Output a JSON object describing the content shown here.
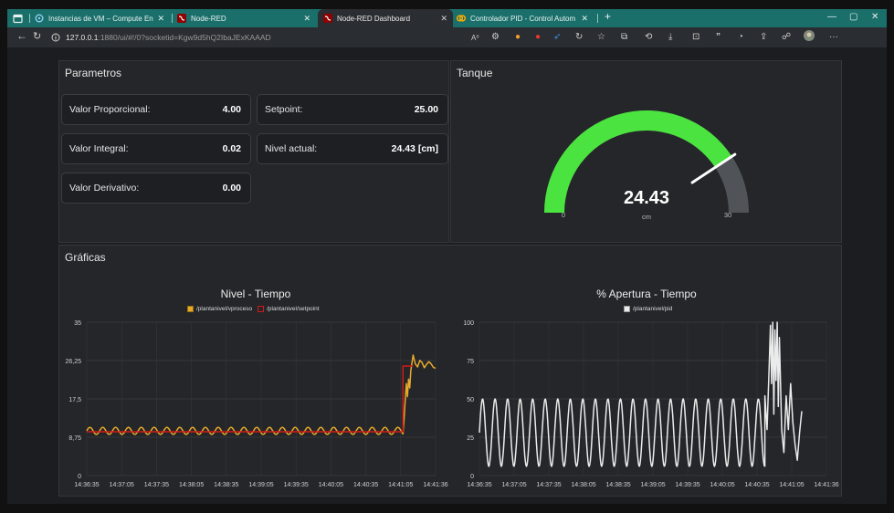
{
  "browser": {
    "tabs": [
      {
        "label": "Instancias de VM – Compute En",
        "active": false
      },
      {
        "label": "Node-RED",
        "active": false
      },
      {
        "label": "Node-RED Dashboard",
        "active": true
      },
      {
        "label": "Controlador PID - Control Autom",
        "active": false
      }
    ],
    "new_tab": "+",
    "url_host": "127.0.0.1",
    "url_rest": ":1880/ui/#!/0?socketid=Kgw9d5hQ2IbaJExKAAAD",
    "reading_mode": "A⁰",
    "quote_glyph": "”"
  },
  "parametros": {
    "title": "Parametros",
    "items": [
      {
        "label": "Valor Proporcional:",
        "value": "4.00"
      },
      {
        "label": "Valor Integral:",
        "value": "0.02"
      },
      {
        "label": "Valor Derivativo:",
        "value": "0.00"
      },
      {
        "label": "Setpoint:",
        "value": "25.00"
      },
      {
        "label": "Nivel actual:",
        "value": "24.43 [cm]"
      }
    ]
  },
  "tanque": {
    "title": "Tanque",
    "value": 24.43,
    "value_text": "24.43",
    "unit": "cm",
    "min": 0,
    "max": 30,
    "min_label": "0",
    "max_label": "30",
    "fill_color": "#4be33f",
    "track_color": "#505458",
    "needle_color": "#ffffff"
  },
  "graficas": {
    "title": "Gráficas"
  },
  "chart_data": [
    {
      "type": "line",
      "title": "Nivel - Tiempo",
      "x_ticks": [
        "14:36:35",
        "14:37:05",
        "14:37:35",
        "14:38:05",
        "14:38:35",
        "14:39:05",
        "14:39:35",
        "14:40:05",
        "14:40:35",
        "14:41:05",
        "14:41:36"
      ],
      "y_ticks": [
        "0",
        "8,75",
        "17,5",
        "26,25",
        "35"
      ],
      "ylim": [
        0,
        35
      ],
      "grid": true,
      "series": [
        {
          "name": "/plantanivel/vproceso",
          "color": "#e7ab2c",
          "segments": [
            {
              "t_start": 0,
              "t_end": 281,
              "base": 10.2,
              "amp": 0.8,
              "period": 11.4
            },
            {
              "points": [
                [
                  281,
                  9.5
                ],
                [
                  282,
                  13
                ],
                [
                  283,
                  17
                ],
                [
                  284,
                  21
                ],
                [
                  285,
                  18
                ],
                [
                  286,
                  22
                ],
                [
                  287,
                  20
                ],
                [
                  288,
                  24
                ],
                [
                  290,
                  27.5
                ],
                [
                  292,
                  25.5
                ],
                [
                  294,
                  24.8
                ],
                [
                  296,
                  26.3
                ],
                [
                  298,
                  25.8
                ],
                [
                  300,
                  24.6
                ],
                [
                  302,
                  25.4
                ],
                [
                  304,
                  26
                ],
                [
                  306,
                  25.5
                ],
                [
                  308,
                  24.7
                ],
                [
                  310,
                  24.5
                ]
              ]
            }
          ]
        },
        {
          "name": "/plantanivel/setpoint",
          "color": "#d11a1a",
          "points": [
            [
              0,
              10
            ],
            [
              280,
              10
            ],
            [
              281,
              10
            ],
            [
              281,
              25
            ],
            [
              290,
              25
            ]
          ]
        }
      ]
    },
    {
      "type": "line",
      "title": "% Apertura - Tiempo",
      "x_ticks": [
        "14:36:35",
        "14:37:05",
        "14:37:35",
        "14:38:05",
        "14:38:35",
        "14:39:05",
        "14:39:35",
        "14:40:05",
        "14:40:35",
        "14:41:05",
        "14:41:36"
      ],
      "y_ticks": [
        "0",
        "25",
        "50",
        "75",
        "100"
      ],
      "ylim": [
        0,
        100
      ],
      "grid": true,
      "series": [
        {
          "name": "/plantanivel/pid",
          "color": "#ebebeb",
          "segments": [
            {
              "t_start": 0,
              "t_end": 255,
              "base": 28,
              "amp": 22,
              "period": 11.2
            },
            {
              "points": [
                [
                  255,
                  52
                ],
                [
                  257,
                  30
                ],
                [
                  259,
                  75
                ],
                [
                  260,
                  98
                ],
                [
                  261,
                  60
                ],
                [
                  262,
                  100
                ],
                [
                  263,
                  40
                ],
                [
                  264,
                  95
                ],
                [
                  265,
                  62
                ],
                [
                  266,
                  100
                ],
                [
                  267,
                  45
                ],
                [
                  268,
                  90
                ],
                [
                  270,
                  30
                ],
                [
                  272,
                  15
                ],
                [
                  274,
                  52
                ],
                [
                  276,
                  30
                ],
                [
                  278,
                  60
                ],
                [
                  280,
                  35
                ],
                [
                  282,
                  20
                ],
                [
                  284,
                  10
                ],
                [
                  286,
                  28
                ],
                [
                  288,
                  42
                ]
              ]
            }
          ]
        }
      ]
    }
  ]
}
